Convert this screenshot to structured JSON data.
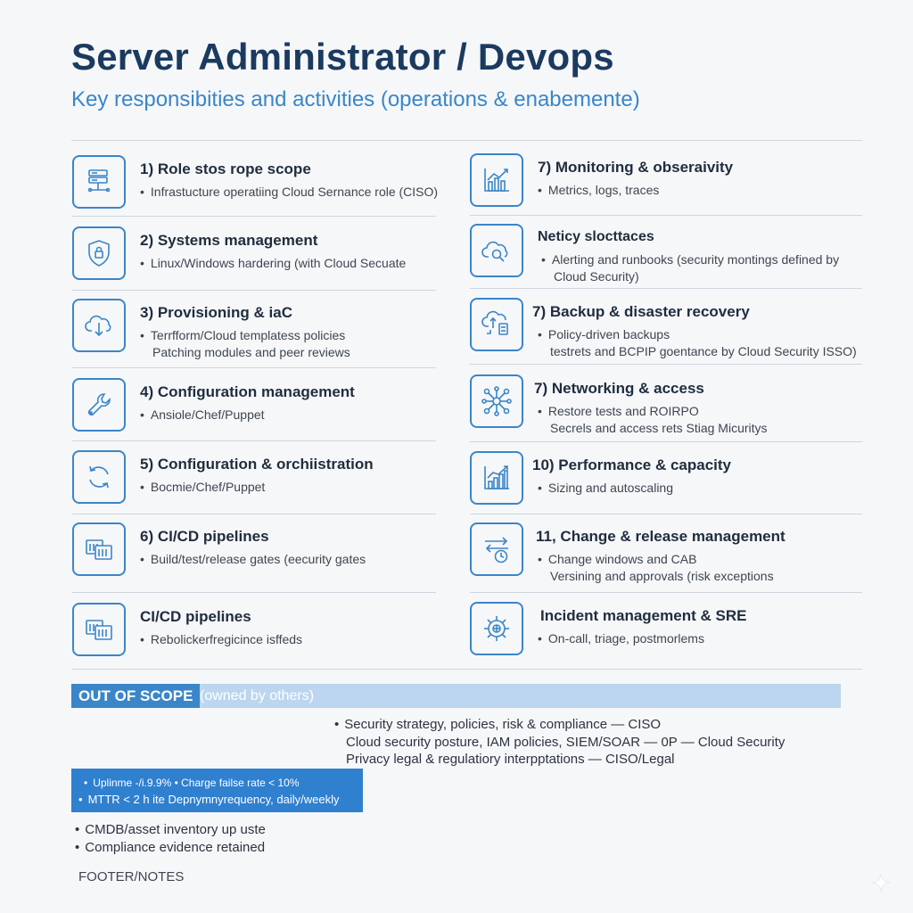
{
  "header": {
    "title": "Server Administrator / Devops",
    "subtitle": "Key responsibities and activities (operations & enabemente)"
  },
  "left_items": [
    {
      "icon": "server-rack-icon",
      "title": "1) Role stos rope scope",
      "bullets": [
        "Infrastucture operatiing Cloud Sernance role (CISO)"
      ]
    },
    {
      "icon": "shield-icon",
      "title": "2) Systems management",
      "bullets": [
        "Linux/Windows hardering (with Cloud Secuate"
      ]
    },
    {
      "icon": "cloud-download-icon",
      "title": "3) Provisioning & iaC",
      "bullets": [
        "Terrfform/Cloud templatess policies",
        "Patching modules and peer reviews"
      ]
    },
    {
      "icon": "wrench-icon",
      "title": "4) Configuration management",
      "bullets": [
        "Ansiole/Chef/Puppet"
      ]
    },
    {
      "icon": "refresh-icon",
      "title": "5) Configuration & orchiistration",
      "bullets": [
        "Bocmie/Chef/Puppet"
      ]
    },
    {
      "icon": "pipeline-icon",
      "title": "6) CI/CD pipelines",
      "bullets": [
        "Build/test/release gates (eecurity gates"
      ]
    },
    {
      "icon": "pipeline-icon",
      "title": "CI/CD pipelines",
      "bullets": [
        "Rebolickerfregicince isffeds"
      ]
    }
  ],
  "right_items": [
    {
      "icon": "bar-chart-icon",
      "title": "7) Monitoring & obseraivity",
      "bullets": [
        "Metrics, logs, traces"
      ]
    },
    {
      "icon": "cloud-search-icon",
      "title": "Neticy slocttaces",
      "bullets": [
        "Alerting and runbooks (security montings defined by",
        "Cloud Security)"
      ]
    },
    {
      "icon": "cloud-backup-icon",
      "title": "7) Backup & disaster recovery",
      "bullets": [
        "Policy-driven backups",
        "testrets and BCPIP goentance by Cloud Security ISSO)"
      ]
    },
    {
      "icon": "network-icon",
      "title": "7) Networking & access",
      "bullets": [
        "Restore tests and ROIRPO",
        "Secrels and access rets Stiag Micuritys"
      ]
    },
    {
      "icon": "performance-chart-icon",
      "title": "10) Performance & capacity",
      "bullets": [
        "Sizing and autoscaling"
      ]
    },
    {
      "icon": "change-clock-icon",
      "title": "11, Change & release management",
      "bullets": [
        "Change windows and CAB",
        "Versining and approvals (risk exceptions"
      ]
    },
    {
      "icon": "gear-icon",
      "title": "Incident management & SRE",
      "bullets": [
        "On-call, triage, postmorlems"
      ]
    }
  ],
  "out_of_scope": {
    "label": "OUT OF SCOPE",
    "note": "(owned by others)",
    "items": [
      "Security strategy, policies, risk & compliance — CISO",
      "Cloud security posture, IAM policies, SIEM/SOAR — 0P — Cloud Security",
      "Privacy legal & regulatiory interpptations — CISO/Legal"
    ]
  },
  "kpis": {
    "line1": "Uplinme -/i.9.9% • Charge failse rate < 10%",
    "line2": "MTTR < 2 h ite Depnymnyrequency, daily/weekly"
  },
  "extra_items": [
    "CMDB/asset inventory up uste",
    "Compliance evidence retained"
  ],
  "footer": "FOOTER/NOTES",
  "colors": {
    "accent": "#3a86c8",
    "title": "#1b3a5f",
    "scope_bar": "#bcd6ef",
    "kpi_bg": "#2f80cf"
  }
}
